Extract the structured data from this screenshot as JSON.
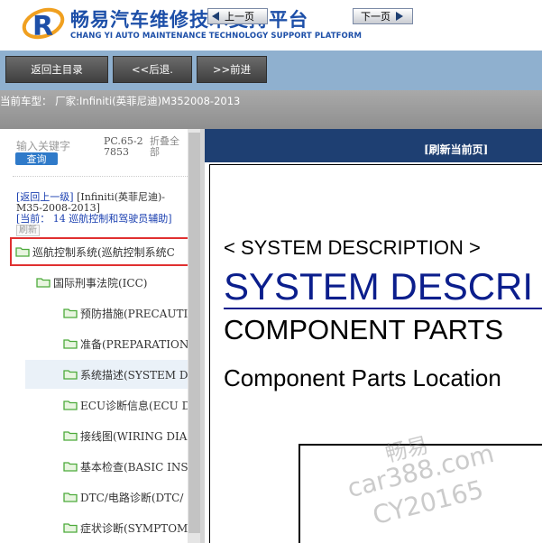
{
  "header": {
    "title": "畅易汽车维修技术支持平台",
    "subtitle": "CHANG YI AUTO MAINTENANCE TECHNOLOGY SUPPORT PLATFORM",
    "logo_letter": "R"
  },
  "nav": {
    "home_label": "返回主目录",
    "back_label": "<<后退.",
    "forward_label": ">>前进"
  },
  "vehicle_info": "当前车型： 厂家:Infiniti(英菲尼迪)M352008-2013",
  "left_panel": {
    "search_placeholder": "输入关键字",
    "search_button": "查询",
    "code": "PC.65-27853",
    "collapse_label": "折叠全部",
    "breadcrumb": {
      "back_label": "[返回上一级]",
      "parent_text": "[Infiniti(英菲尼迪)-M35-2008-2013]",
      "current_label": "[当前：",
      "current_value": "14 巡航控制和驾驶员辅助]",
      "refresh_label": "刷新"
    },
    "tree": [
      {
        "label": "巡航控制系统(巡航控制系统C",
        "level": 0,
        "highlighted": true
      },
      {
        "label": "国际刑事法院(ICC)",
        "level": 1
      },
      {
        "label": "预防措施(PRECAUTI",
        "level": 2
      },
      {
        "label": "准备(PREPARATION)",
        "level": 2
      },
      {
        "label": "系统描述(SYSTEM D",
        "level": 2,
        "selected": true
      },
      {
        "label": "ECU诊断信息(ECU D",
        "level": 2
      },
      {
        "label": "接线图(WIRING DIA",
        "level": 2
      },
      {
        "label": "基本检查(BASIC INS",
        "level": 2
      },
      {
        "label": "DTC/电路诊断(DTC/",
        "level": 2
      },
      {
        "label": "症状诊断(SYMPTOM",
        "level": 2
      }
    ]
  },
  "viewer": {
    "prev_label": "上一页",
    "next_label": "下一页",
    "refresh_label": "[刷新当前页]",
    "doc_heading_small": "< SYSTEM DESCRIPTION >",
    "doc_heading_large": "SYSTEM DESCRI",
    "doc_heading_section": "COMPONENT PARTS",
    "doc_heading_sub": "Component Parts Location"
  },
  "watermark": {
    "line1": "畅易",
    "line2": "car388.com",
    "line3": "CY20165"
  },
  "colors": {
    "brand_blue": "#1d4fa8",
    "nav_bar": "#8fb0cf",
    "viewer_bar": "#1e3f72",
    "highlight_border": "#e03030",
    "folder_green": "#4caa3a"
  }
}
